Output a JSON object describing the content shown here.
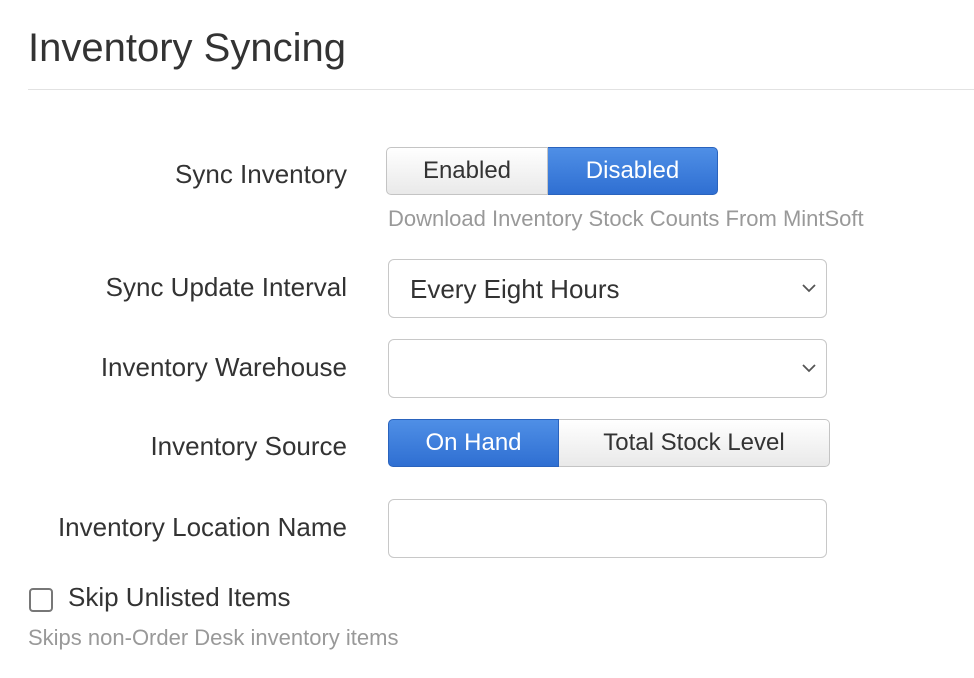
{
  "section": {
    "title": "Inventory Syncing"
  },
  "sync_inventory": {
    "label": "Sync Inventory",
    "options": [
      "Enabled",
      "Disabled"
    ],
    "selected": "Disabled",
    "help": "Download Inventory Stock Counts From MintSoft"
  },
  "sync_update_interval": {
    "label": "Sync Update Interval",
    "value": "Every Eight Hours"
  },
  "inventory_warehouse": {
    "label": "Inventory Warehouse",
    "value": ""
  },
  "inventory_source": {
    "label": "Inventory Source",
    "options": [
      "On Hand",
      "Total Stock Level"
    ],
    "selected": "On Hand"
  },
  "inventory_location_name": {
    "label": "Inventory Location Name",
    "value": ""
  },
  "skip_unlisted": {
    "label": "Skip Unlisted Items",
    "checked": false,
    "help": "Skips non-Order Desk inventory items"
  },
  "icons": {
    "dropdown": "chevron-down-icon"
  },
  "colors": {
    "accent": "#3a7bdc",
    "help_text": "#999999"
  }
}
